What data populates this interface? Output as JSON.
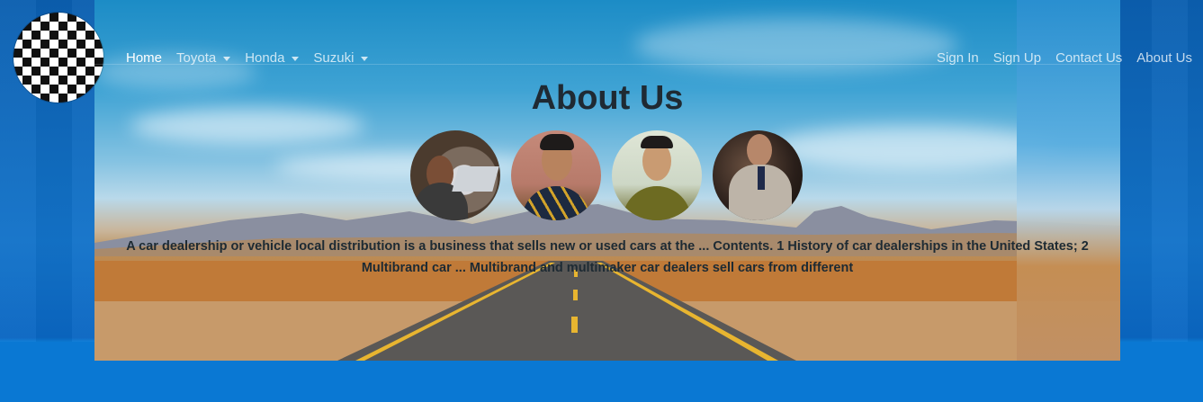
{
  "brand": {
    "logo_icon": "car-brands-logo-icon"
  },
  "nav": {
    "left": [
      {
        "label": "Home",
        "active": true,
        "dropdown": false
      },
      {
        "label": "Toyota",
        "active": false,
        "dropdown": true
      },
      {
        "label": "Honda",
        "active": false,
        "dropdown": true
      },
      {
        "label": "Suzuki",
        "active": false,
        "dropdown": true
      }
    ],
    "right": [
      {
        "label": "Sign In"
      },
      {
        "label": "Sign Up"
      },
      {
        "label": "Contact Us"
      },
      {
        "label": "About Us"
      }
    ]
  },
  "main": {
    "title": "About Us",
    "team_photos": [
      "team-photo-1",
      "team-photo-2",
      "team-photo-3",
      "team-photo-4"
    ],
    "description": "A car dealership or vehicle local distribution is a business that sells new or used cars at the ... Contents. 1 History of car dealerships in the United States; 2 Multibrand car ... Multibrand and multimaker car dealers sell cars from different"
  },
  "colors": {
    "page_bg": "#0b6cc4",
    "nav_text": "#ffffff",
    "title_text": "#1f2a33"
  }
}
